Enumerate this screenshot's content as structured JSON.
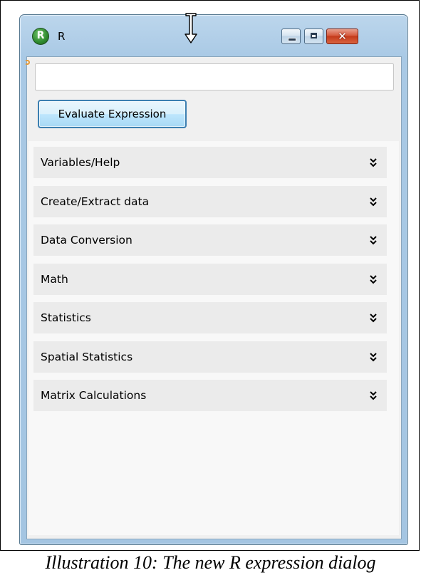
{
  "window": {
    "title": "R",
    "app_icon_letter": "R"
  },
  "titlebar_buttons": {
    "minimize_icon": "minimize-icon",
    "maximize_icon": "maximize-icon",
    "close_glyph": "✕"
  },
  "expression": {
    "value": "",
    "placeholder": ""
  },
  "evaluate_button_label": "Evaluate Expression",
  "sections": [
    {
      "label": "Variables/Help",
      "icon": "double-chevron-down-icon"
    },
    {
      "label": "Create/Extract data",
      "icon": "double-chevron-down-icon"
    },
    {
      "label": "Data Conversion",
      "icon": "double-chevron-down-icon"
    },
    {
      "label": "Math",
      "icon": "double-chevron-down-icon"
    },
    {
      "label": "Statistics",
      "icon": "double-chevron-down-icon"
    },
    {
      "label": "Spatial Statistics",
      "icon": "double-chevron-down-icon"
    },
    {
      "label": "Matrix Calculations",
      "icon": "double-chevron-down-icon"
    }
  ],
  "caption": "Illustration 10: The new R expression dialog",
  "colors": {
    "titlebar": "#a9c9e5",
    "close_button": "#c43a1b",
    "button_border": "#3c7fb1",
    "section_bg": "#ebebeb"
  }
}
